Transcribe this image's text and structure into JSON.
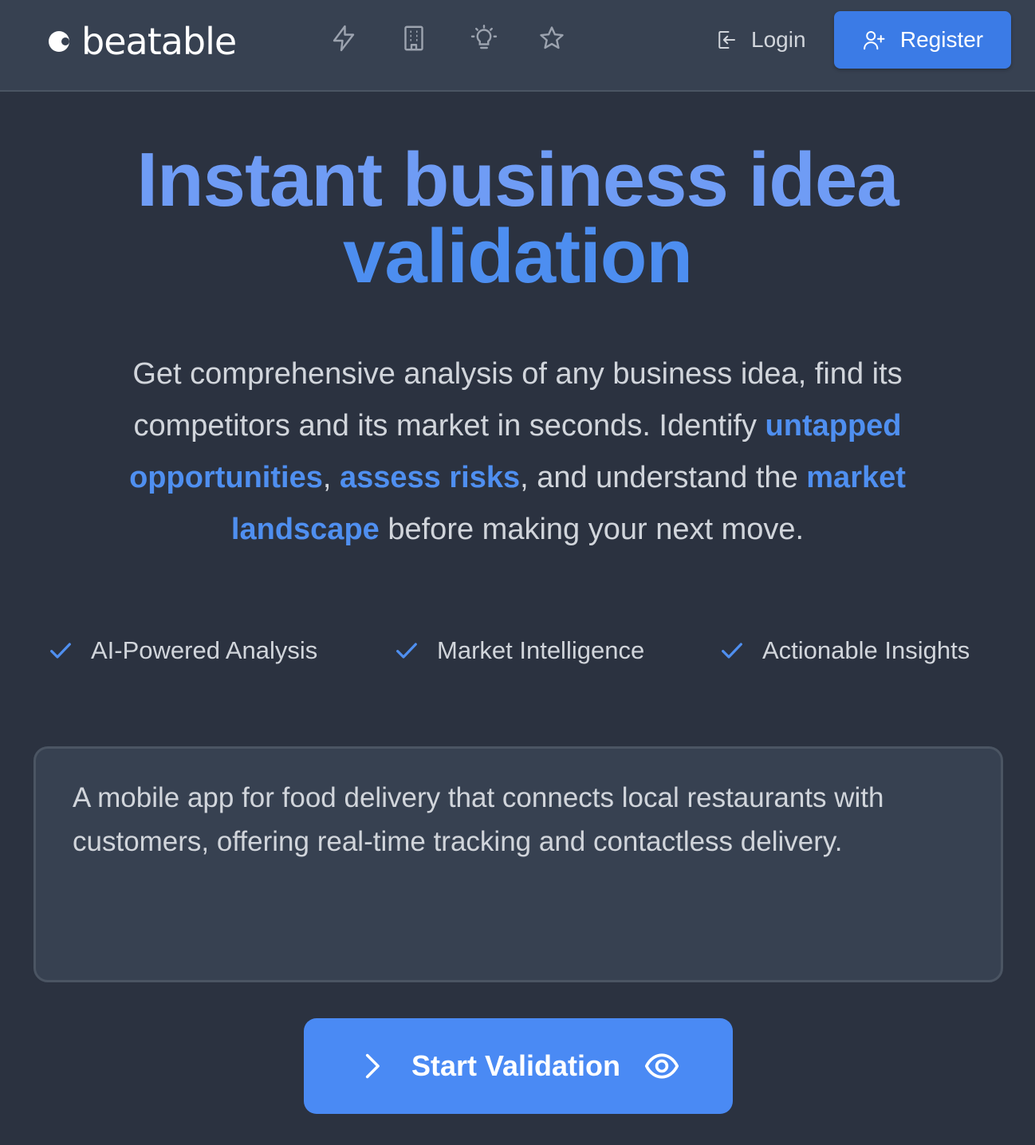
{
  "brand": {
    "name": "beatable"
  },
  "nav": {
    "icons": [
      "bolt-icon",
      "building-icon",
      "lightbulb-icon",
      "star-icon"
    ],
    "login_label": "Login",
    "register_label": "Register"
  },
  "hero": {
    "title_line1": "Instant business idea",
    "title_line2": "validation"
  },
  "description": {
    "part1": "Get comprehensive analysis of any business idea, find its competitors and its market in seconds. Identify ",
    "hl1": "untapped opportunities",
    "sep1": ", ",
    "hl2": "assess risks",
    "part2": ", and understand the ",
    "hl3": "market landscape",
    "part3": " before making your next move."
  },
  "features": [
    {
      "label": "AI-Powered Analysis"
    },
    {
      "label": "Market Intelligence"
    },
    {
      "label": "Actionable Insights"
    }
  ],
  "idea_input": {
    "value": "A mobile app for food delivery that connects local restaurants with customers, offering real-time tracking and contactless delivery."
  },
  "cta": {
    "label": "Start Validation"
  },
  "colors": {
    "background": "#2b3240",
    "navbar": "#374151",
    "accent": "#4a8af4",
    "title": "#6f9cf5"
  }
}
